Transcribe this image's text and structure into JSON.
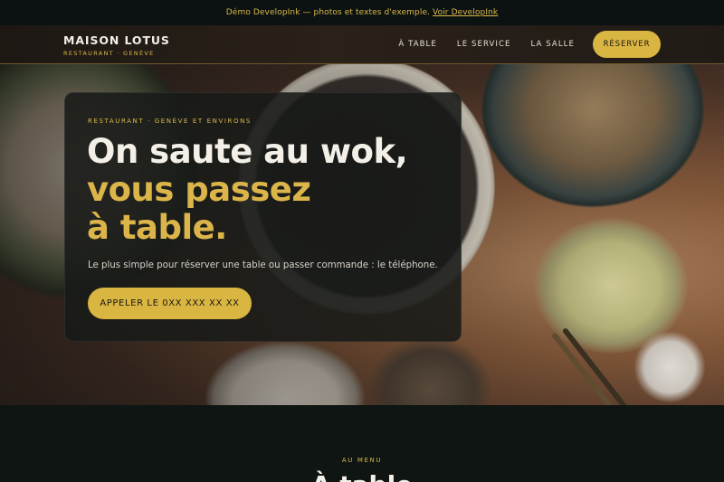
{
  "demo_banner": {
    "text": "Démo DevelopInk — photos et textes d'exemple.",
    "link": "Voir DevelopInk"
  },
  "header": {
    "brand_name": "MAISON LOTUS",
    "brand_sub": "RESTAURANT · GENÈVE",
    "nav": [
      "À TABLE",
      "LE SERVICE",
      "LA SALLE"
    ],
    "cta": "RÉSERVER"
  },
  "hero": {
    "kicker": "RESTAURANT · GENÈVE ET ENVIRONS",
    "headline_line1": "On saute au wok,",
    "headline_line2": "vous passez",
    "headline_line3": "à table.",
    "lead": "Le plus simple pour réserver une table ou passer commande : le téléphone.",
    "call_button": "APPELER LE 0XX XXX XX XX"
  },
  "menu_section": {
    "kicker": "AU MENU",
    "title": "À table"
  },
  "colors": {
    "accent": "#d9b542",
    "background": "#0f1513",
    "card": "#181a18"
  }
}
